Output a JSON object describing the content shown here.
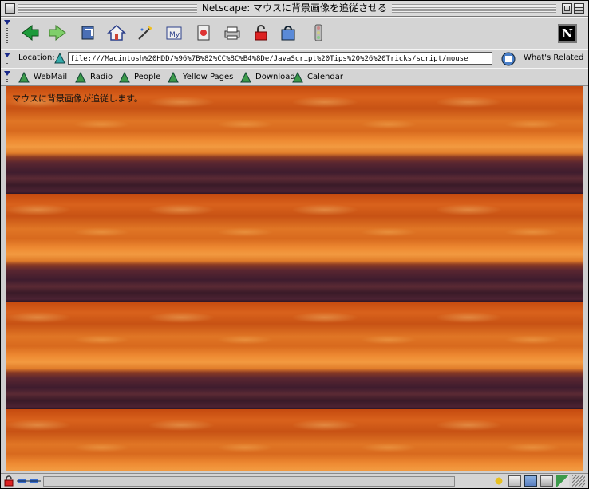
{
  "window": {
    "title": "Netscape: マウスに背景画像を追従させる"
  },
  "nav_toolbar": {
    "buttons": [
      {
        "name": "back-button",
        "icon": "back-arrow-icon"
      },
      {
        "name": "forward-button",
        "icon": "forward-arrow-icon"
      },
      {
        "name": "reload-button",
        "icon": "reload-icon"
      },
      {
        "name": "home-button",
        "icon": "home-icon"
      },
      {
        "name": "search-button",
        "icon": "search-icon"
      },
      {
        "name": "my-netscape-button",
        "icon": "my-netscape-icon"
      },
      {
        "name": "images-button",
        "icon": "images-icon"
      },
      {
        "name": "print-button",
        "icon": "print-icon"
      },
      {
        "name": "security-button",
        "icon": "lock-icon"
      },
      {
        "name": "shop-button",
        "icon": "shop-icon"
      },
      {
        "name": "stop-button",
        "icon": "stop-icon"
      }
    ],
    "logo": "N"
  },
  "location_bar": {
    "label": "Location:",
    "url": "file:///Macintosh%20HDD/%96%7B%82%CC%8C%B4%8De/JavaScript%20Tips%20%26%20Tricks/script/mouse",
    "related_label": "What's Related"
  },
  "personal_toolbar": {
    "items": [
      "WebMail",
      "Radio",
      "People",
      "Yellow Pages",
      "Download",
      "Calendar"
    ]
  },
  "page": {
    "text": "マウスに背景画像が追従します。"
  },
  "colors": {
    "sky_orange": "#e07625",
    "land_dark": "#3e1c2e",
    "chrome": "#d4d4d4"
  }
}
